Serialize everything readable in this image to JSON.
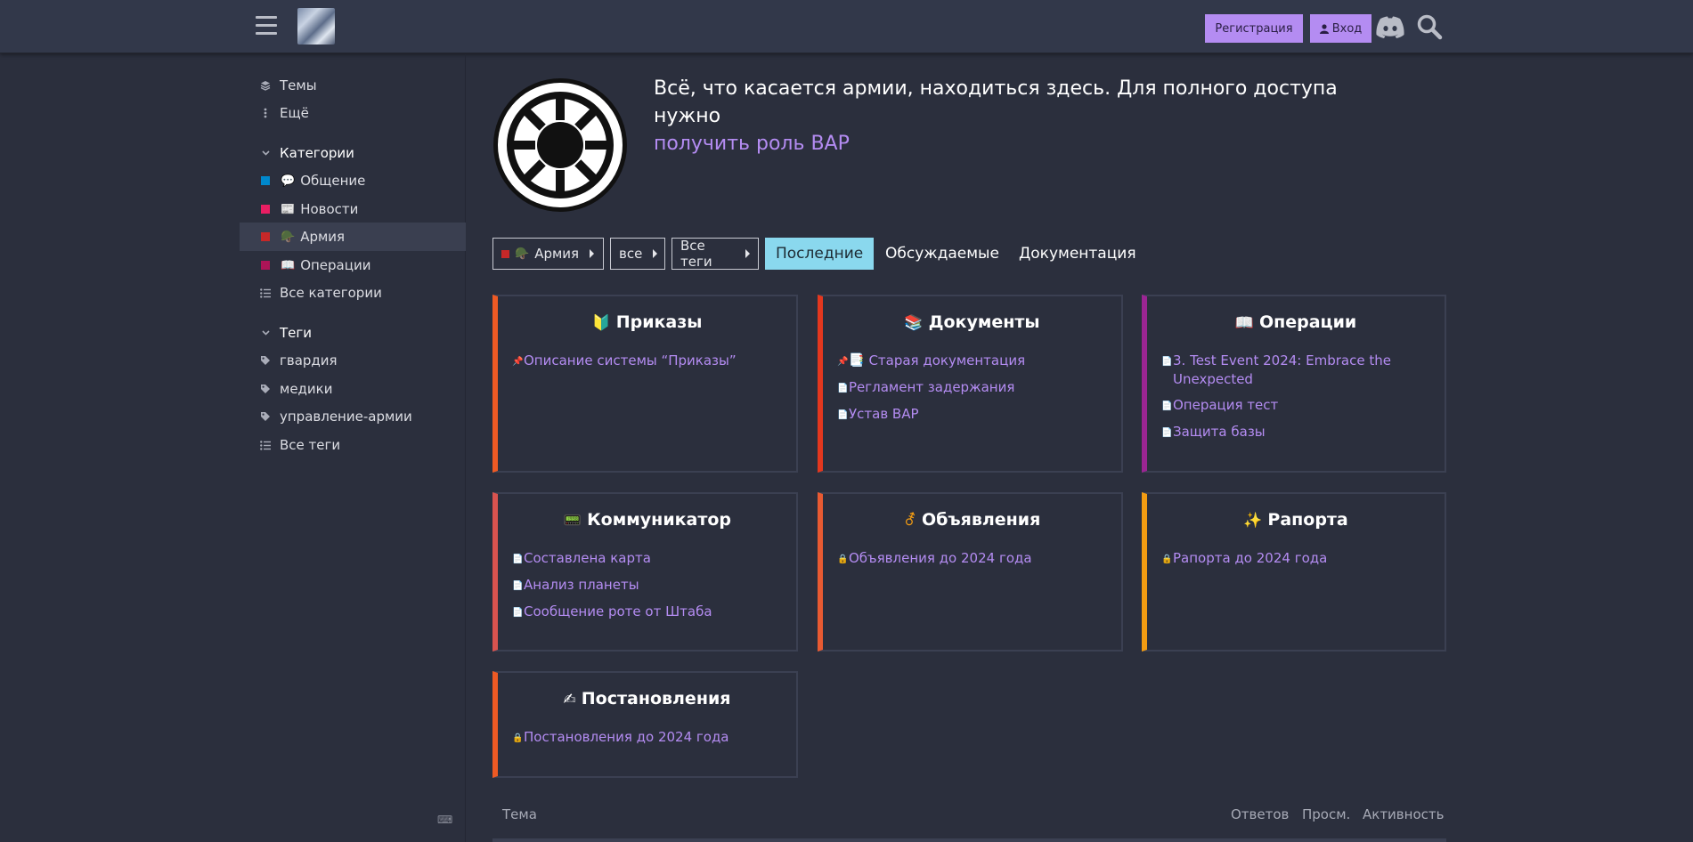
{
  "header": {
    "signup_label": "Регистрация",
    "login_label": "Вход",
    "icons": [
      "menu-icon",
      "site-logo",
      "user-icon",
      "discord-icon",
      "search-icon"
    ]
  },
  "sidebar": {
    "topics_label": "Темы",
    "more_label": "Ещё",
    "categories_heading": "Категории",
    "categories": [
      {
        "label": "Общение",
        "color": "#0088cc",
        "emoji": "💬"
      },
      {
        "label": "Новости",
        "color": "#e91e63",
        "emoji": "📰"
      },
      {
        "label": "Армия",
        "color": "#c62828",
        "emoji": "🪖"
      },
      {
        "label": "Операции",
        "color": "#ad1457",
        "emoji": "📖"
      }
    ],
    "all_categories_label": "Все категории",
    "tags_heading": "Теги",
    "tags": [
      "гвардия",
      "медики",
      "управление-армии"
    ],
    "all_tags_label": "Все теги"
  },
  "hero": {
    "text": "Всё, что касается армии, находиться здесь. Для полного доступа нужно",
    "link": "получить роль ВАР"
  },
  "nav": {
    "category_drop": "Армия",
    "subcat_drop": "все",
    "tags_drop": "Все теги",
    "tabs": [
      "Последние",
      "Обсуждаемые",
      "Документация"
    ]
  },
  "boxes": [
    {
      "title": "Приказы",
      "emoji": "🔰",
      "border": "#ee5a24",
      "topics": [
        {
          "icon": "📌",
          "text": "Описание системы “Приказы”"
        }
      ]
    },
    {
      "title": "Документы",
      "emoji": "📚",
      "border": "#e3371e",
      "topics": [
        {
          "icon": "📌",
          "extra": "📑",
          "text": "Старая документация"
        },
        {
          "icon": "📄",
          "text": "Регламент задержания"
        },
        {
          "icon": "📄",
          "text": "Устав ВАР"
        }
      ]
    },
    {
      "title": "Операции",
      "emoji": "📖",
      "border": "#9b2593",
      "topics": [
        {
          "icon": "📄",
          "text": "3. Test Event 2024: Embrace the Unexpected"
        },
        {
          "icon": "📄",
          "text": "Операция тест"
        },
        {
          "icon": "📄",
          "text": "Защита базы"
        }
      ]
    },
    {
      "title": "Коммуникатор",
      "emoji": "📟",
      "border": "#d9534f",
      "topics": [
        {
          "icon": "📄",
          "text": "Составлена карта"
        },
        {
          "icon": "📄",
          "text": "Анализ планеты"
        },
        {
          "icon": "📄",
          "text": "Сообщение роте от Штаба"
        }
      ]
    },
    {
      "title": "Объявления",
      "emoji": "⚦",
      "border": "#e85a32",
      "topics": [
        {
          "icon": "🔒",
          "text": "Объявления до 2024 года"
        }
      ]
    },
    {
      "title": "Рапорта",
      "emoji": "✨",
      "border": "#f39c12",
      "topics": [
        {
          "icon": "🔒",
          "text": "Рапорта до 2024 года"
        }
      ]
    },
    {
      "title": "Постановления",
      "emoji": "✍",
      "border": "#ee5a24",
      "topics": [
        {
          "icon": "🔒",
          "text": "Постановления до 2024 года"
        }
      ]
    }
  ],
  "table": {
    "topic": "Тема",
    "replies": "Ответов",
    "views": "Просм.",
    "activity": "Активность"
  },
  "keyboard_icon": "⌨"
}
